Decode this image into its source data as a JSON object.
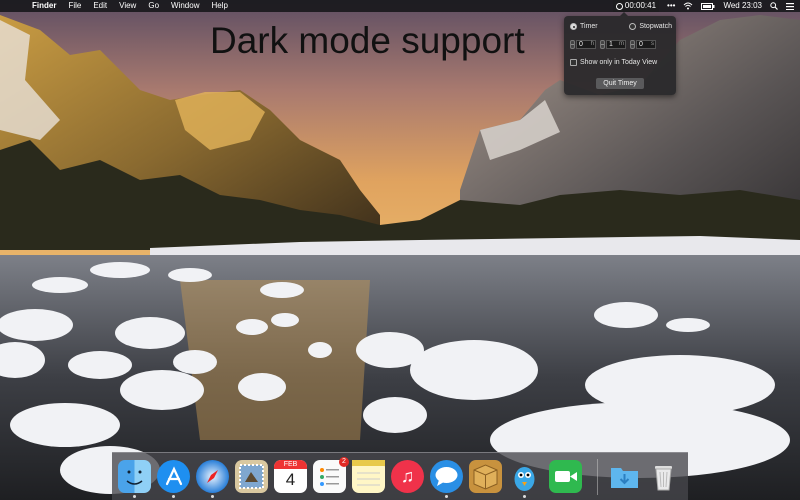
{
  "menubar": {
    "apple_glyph": "",
    "app_name": "Finder",
    "menus": [
      "File",
      "Edit",
      "View",
      "Go",
      "Window",
      "Help"
    ],
    "timer_time": "00:00:41",
    "dots": "•••",
    "datetime": "Wed 23:03"
  },
  "headline": "Dark mode support",
  "popover": {
    "radio_timer": "Timer",
    "radio_stopwatch": "Stopwatch",
    "hours_value": "0",
    "hours_unit": "h",
    "minutes_value": "1",
    "minutes_unit": "m",
    "seconds_value": "0",
    "seconds_unit": "s",
    "checkbox_label": "Show only in Today View",
    "quit_label": "Quit Timey"
  },
  "dock": {
    "calendar_month": "FEB",
    "calendar_day": "4",
    "reminders_badge": "2"
  },
  "colors": {
    "menubar": "#19191c",
    "popover": "#28282a",
    "dock": "#46464b"
  }
}
